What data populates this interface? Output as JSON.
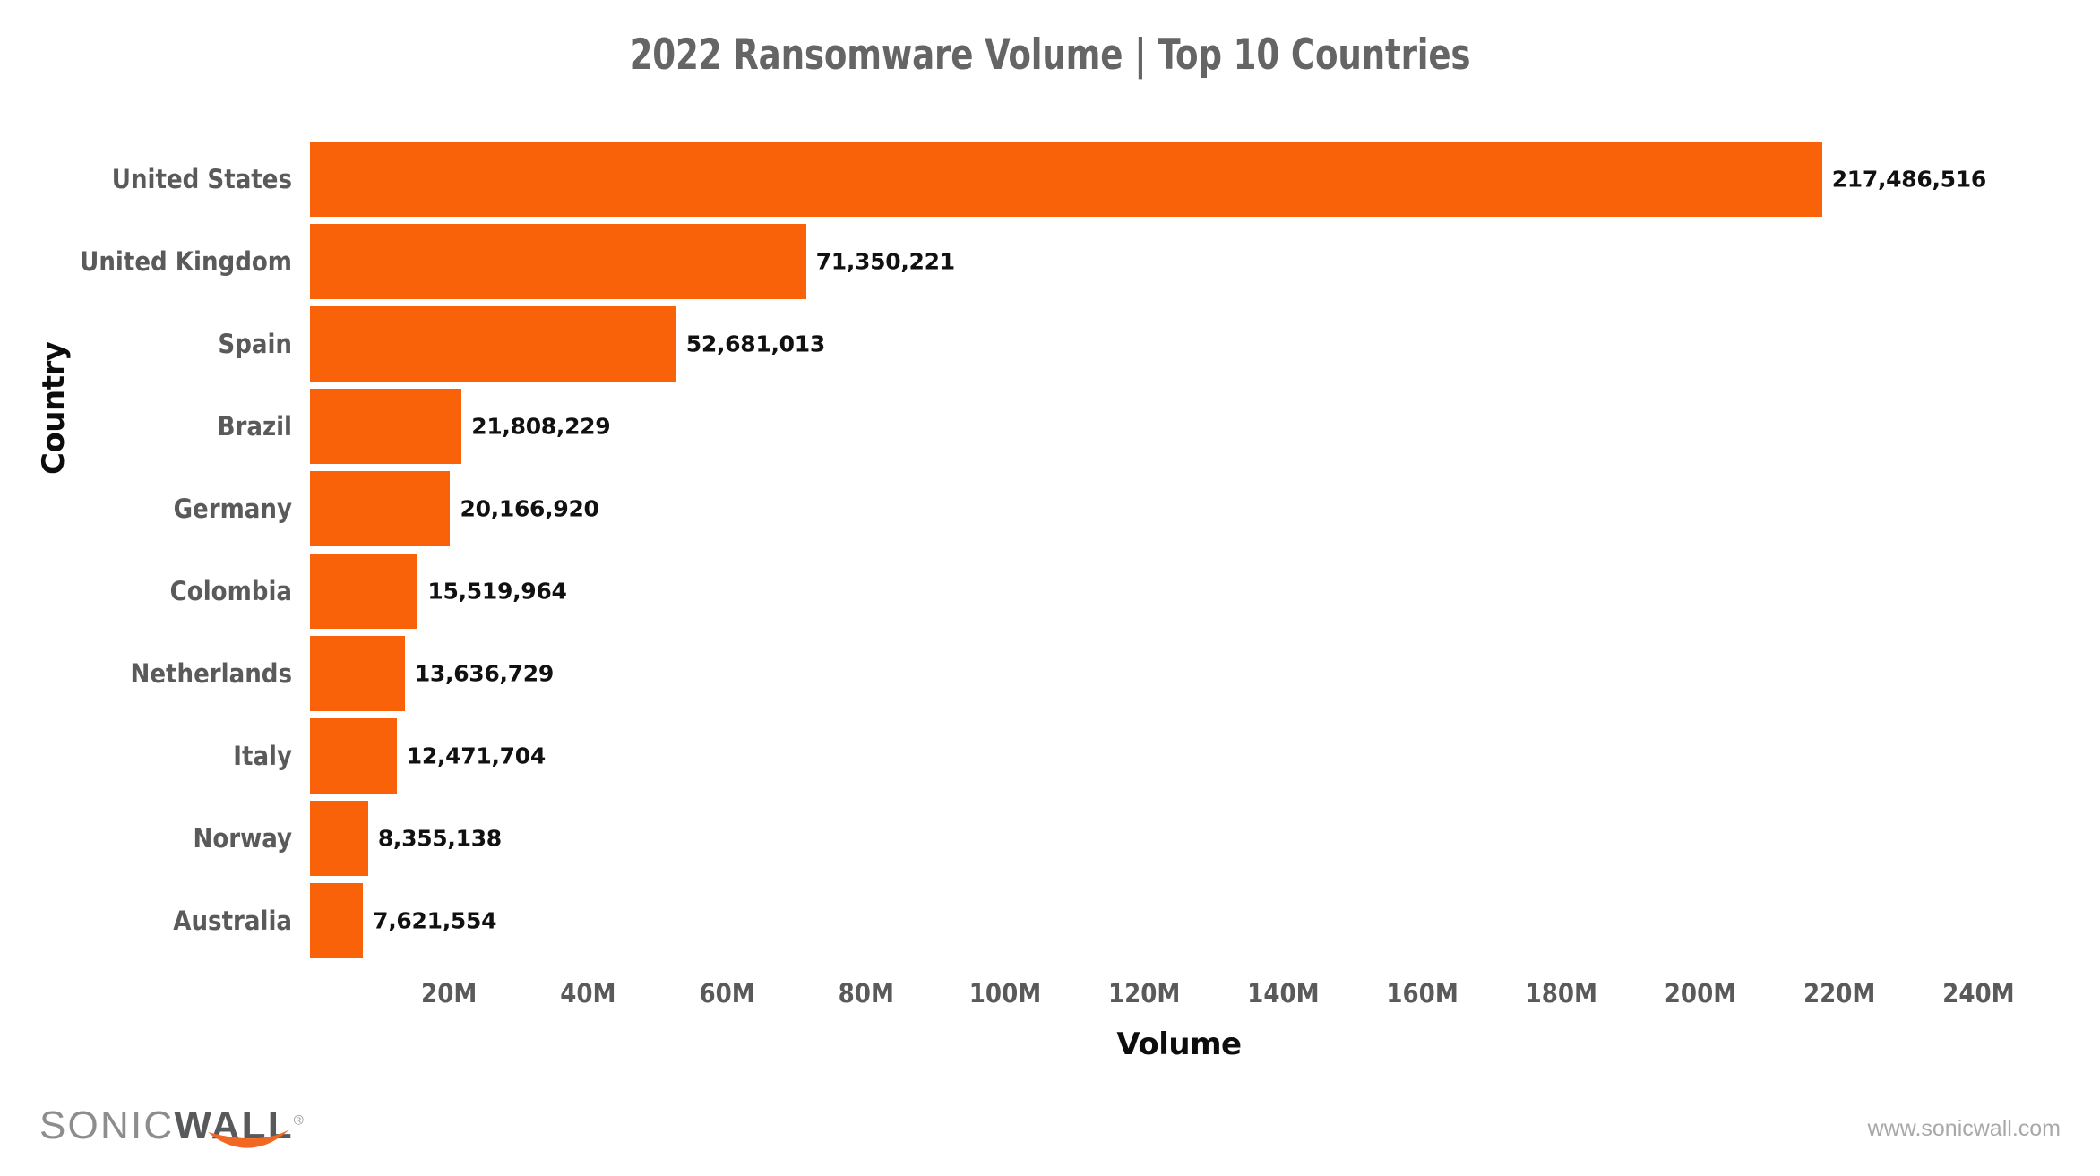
{
  "page": {
    "background_color": "#ffffff",
    "accent_color": "#F96208"
  },
  "header": {
    "title": "2022 Ransomware Volume | Top 10 Countries"
  },
  "footer": {
    "logo_primary": "SONIC",
    "logo_secondary": "WALL",
    "logo_registered": "®",
    "url": "www.sonicwall.com"
  },
  "chart_data": {
    "type": "bar",
    "orientation": "horizontal",
    "title": "2022 Ransomware Volume | Top 10 Countries",
    "xlabel": "Volume",
    "ylabel": "Country",
    "categories": [
      "United States",
      "United Kingdom",
      "Spain",
      "Brazil",
      "Germany",
      "Colombia",
      "Netherlands",
      "Italy",
      "Norway",
      "Australia"
    ],
    "values": [
      217486516,
      71350221,
      52681013,
      21808229,
      20166920,
      15519964,
      13636729,
      12471704,
      8355138,
      7621554
    ],
    "value_labels": [
      "217,486,516",
      "71,350,221",
      "52,681,013",
      "21,808,229",
      "20,166,920",
      "15,519,964",
      "13,636,729",
      "12,471,704",
      "8,355,138",
      "7,621,554"
    ],
    "bar_color": "#F96208",
    "xlim": [
      0,
      250000000
    ],
    "xticks": [
      20000000,
      40000000,
      60000000,
      80000000,
      100000000,
      120000000,
      140000000,
      160000000,
      180000000,
      200000000,
      220000000,
      240000000
    ],
    "xtick_labels": [
      "20M",
      "40M",
      "60M",
      "80M",
      "100M",
      "120M",
      "140M",
      "160M",
      "180M",
      "200M",
      "220M",
      "240M"
    ],
    "grid": false,
    "legend": false
  }
}
